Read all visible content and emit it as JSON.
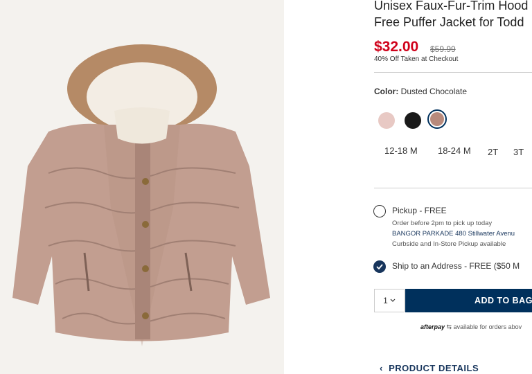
{
  "product": {
    "title_line1": "Unisex Faux-Fur-Trim Hood",
    "title_line2": "Free Puffer Jacket for Todd",
    "price": "$32.00",
    "original_price": "$59.99",
    "promo": "40% Off Taken at Checkout",
    "image_alt": "puffer jacket photo"
  },
  "color": {
    "label": "Color:",
    "value": "Dusted Chocolate",
    "swatches": [
      {
        "name": "Light Pink",
        "hex": "#e8c9c4"
      },
      {
        "name": "Black",
        "hex": "#1a1a1a"
      },
      {
        "name": "Dusted Chocolate",
        "hex": "#b88a7c",
        "selected": true
      }
    ]
  },
  "sizes": [
    "12-18 M",
    "18-24 M",
    "2T",
    "3T"
  ],
  "fulfillment": {
    "pickup_label": "Pickup - FREE",
    "pickup_note": "Order before 2pm to pick up today",
    "pickup_store": "BANGOR PARKADE 480 Stillwater Avenu",
    "pickup_extra": "Curbside and In-Store Pickup available",
    "ship_label": "Ship to an Address - FREE ($50 M"
  },
  "cart": {
    "quantity": "1",
    "add_label": "ADD TO BAG"
  },
  "afterpay": {
    "brand": "afterpay",
    "text": "available for orders abov"
  },
  "details_label": "PRODUCT DETAILS",
  "colors": {
    "accent": "#00305c",
    "sale": "#d0021b",
    "link": "#17355c"
  }
}
